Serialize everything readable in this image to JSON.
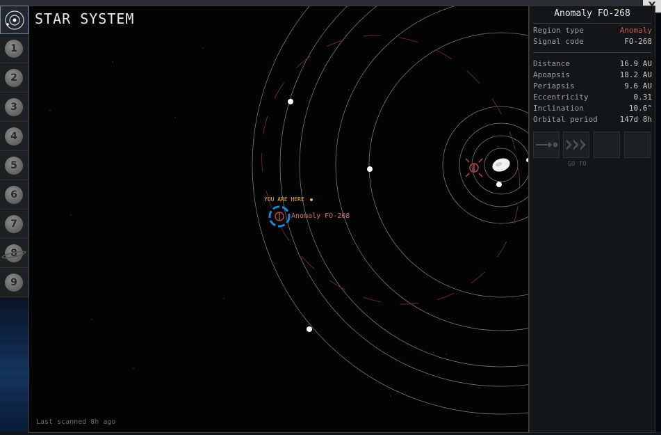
{
  "map": {
    "title": "STAR SYSTEM",
    "last_scanned": "Last scanned 8h ago",
    "you_are_here": "YOU ARE HERE",
    "marker_label": "Anomaly FO-268"
  },
  "rail": {
    "numbers": [
      "1",
      "2",
      "3",
      "4",
      "5",
      "6",
      "7",
      "8",
      "9"
    ]
  },
  "panel": {
    "title": "Anomaly FO-268",
    "close_glyph": "X",
    "info": [
      {
        "label": "Region type",
        "value": "Anomaly"
      },
      {
        "label": "Signal code",
        "value": "FO-268"
      }
    ],
    "orbit": [
      {
        "label": "Distance",
        "value": "16.9 AU"
      },
      {
        "label": "Apoapsis",
        "value": "18.2 AU"
      },
      {
        "label": "Periapsis",
        "value": "9.6 AU"
      },
      {
        "label": "Eccentricity",
        "value": "0.31"
      },
      {
        "label": "Inclination",
        "value": "10.6°"
      },
      {
        "label": "Orbital period",
        "value": "147d 8h"
      }
    ],
    "goto_label": "GO TO"
  },
  "colors": {
    "anomaly": "#c0564a",
    "you_are_here": "#f1b34a",
    "marker": "#1e88d8"
  }
}
